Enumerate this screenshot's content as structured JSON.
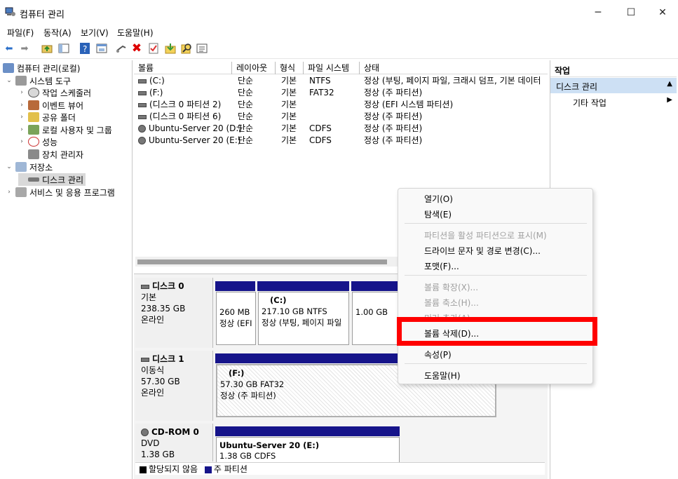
{
  "window": {
    "title": "컴퓨터 관리",
    "minimize": "─",
    "maximize": "☐",
    "close": "✕"
  },
  "menubar": [
    "파일(F)",
    "동작(A)",
    "보기(V)",
    "도움말(H)"
  ],
  "toolbar_icons": [
    "back-icon",
    "forward-icon",
    "up-folder-icon",
    "show-tree-icon",
    "help-icon",
    "properties-icon",
    "connect-icon",
    "delete-icon",
    "check-icon",
    "import-icon",
    "search-icon",
    "view-icon"
  ],
  "tree": [
    {
      "label": "컴퓨터 관리(로컬)",
      "arrow": ""
    },
    {
      "label": "시스템 도구",
      "arrow": "⌄"
    },
    {
      "label": "작업 스케줄러",
      "arrow": "›"
    },
    {
      "label": "이벤트 뷰어",
      "arrow": "›"
    },
    {
      "label": "공유 폴더",
      "arrow": "›"
    },
    {
      "label": "로컬 사용자 및 그룹",
      "arrow": "›"
    },
    {
      "label": "성능",
      "arrow": "›"
    },
    {
      "label": "장치 관리자",
      "arrow": ""
    },
    {
      "label": "저장소",
      "arrow": "⌄"
    },
    {
      "label": "디스크 관리",
      "arrow": ""
    },
    {
      "label": "서비스 및 응용 프로그램",
      "arrow": "›"
    }
  ],
  "volumes": {
    "columns": [
      "볼륨",
      "레이아웃",
      "형식",
      "파일 시스템",
      "상태"
    ],
    "rows": [
      {
        "name": "(C:)",
        "layout": "단순",
        "type": "기본",
        "fs": "NTFS",
        "status": "정상 (부팅, 페이지 파일, 크래시 덤프, 기본 데이터"
      },
      {
        "name": "(F:)",
        "layout": "단순",
        "type": "기본",
        "fs": "FAT32",
        "status": "정상 (주 파티션)"
      },
      {
        "name": "(디스크 0 파티션 2)",
        "layout": "단순",
        "type": "기본",
        "fs": "",
        "status": "정상 (EFI 시스템 파티션)"
      },
      {
        "name": "(디스크 0 파티션 6)",
        "layout": "단순",
        "type": "기본",
        "fs": "",
        "status": "정상 (주 파티션)"
      },
      {
        "name": "Ubuntu-Server 20 (D:)",
        "layout": "단순",
        "type": "기본",
        "fs": "CDFS",
        "status": "정상 (주 파티션)"
      },
      {
        "name": "Ubuntu-Server 20 (E:)",
        "layout": "단순",
        "type": "기본",
        "fs": "CDFS",
        "status": "정상 (주 파티션)"
      }
    ]
  },
  "disks": [
    {
      "name": "디스크 0",
      "kind": "기본",
      "size": "238.35 GB",
      "state": "온라인",
      "parts": [
        {
          "title": "",
          "line1": "260 MB",
          "line2": "정상 (EFI"
        },
        {
          "title": "(C:)",
          "line1": "217.10 GB NTFS",
          "line2": "정상 (부팅, 페이지 파일"
        },
        {
          "title": "",
          "line1": "1.00 GB",
          "line2": ""
        }
      ]
    },
    {
      "name": "디스크 1",
      "kind": "이동식",
      "size": "57.30 GB",
      "state": "온라인",
      "parts": [
        {
          "title": "(F:)",
          "line1": "57.30 GB FAT32",
          "line2": "정상 (주 파티션)"
        }
      ]
    },
    {
      "name": "CD-ROM 0",
      "kind": "DVD",
      "size": "1.38 GB",
      "state": "",
      "parts": [
        {
          "title": "Ubuntu-Server 20  (E:)",
          "line1": "1.38 GB CDFS",
          "line2": ""
        }
      ]
    }
  ],
  "legend": {
    "unallocated": "할당되지 않음",
    "primary": "주 파티션",
    "unallocated_color": "#000000",
    "primary_color": "#16148a"
  },
  "actions": {
    "header": "작업",
    "selected": "디스크 관리",
    "more": "기타 작업"
  },
  "context_menu": [
    {
      "label": "열기(O)",
      "disabled": false
    },
    {
      "label": "탐색(E)",
      "disabled": false
    },
    {
      "label": "파티션을 활성 파티션으로 표시(M)",
      "disabled": true
    },
    {
      "label": "드라이브 문자 및 경로 변경(C)...",
      "disabled": false
    },
    {
      "label": "포맷(F)...",
      "disabled": false
    },
    {
      "label": "볼륨 확장(X)...",
      "disabled": true
    },
    {
      "label": "볼륨 축소(H)...",
      "disabled": true
    },
    {
      "label": "미러 추가(A)...",
      "disabled": true
    },
    {
      "label": "볼륨 삭제(D)...",
      "disabled": false
    },
    {
      "label": "속성(P)",
      "disabled": false
    },
    {
      "label": "도움말(H)",
      "disabled": false
    }
  ],
  "highlight_color": "#ff0000"
}
